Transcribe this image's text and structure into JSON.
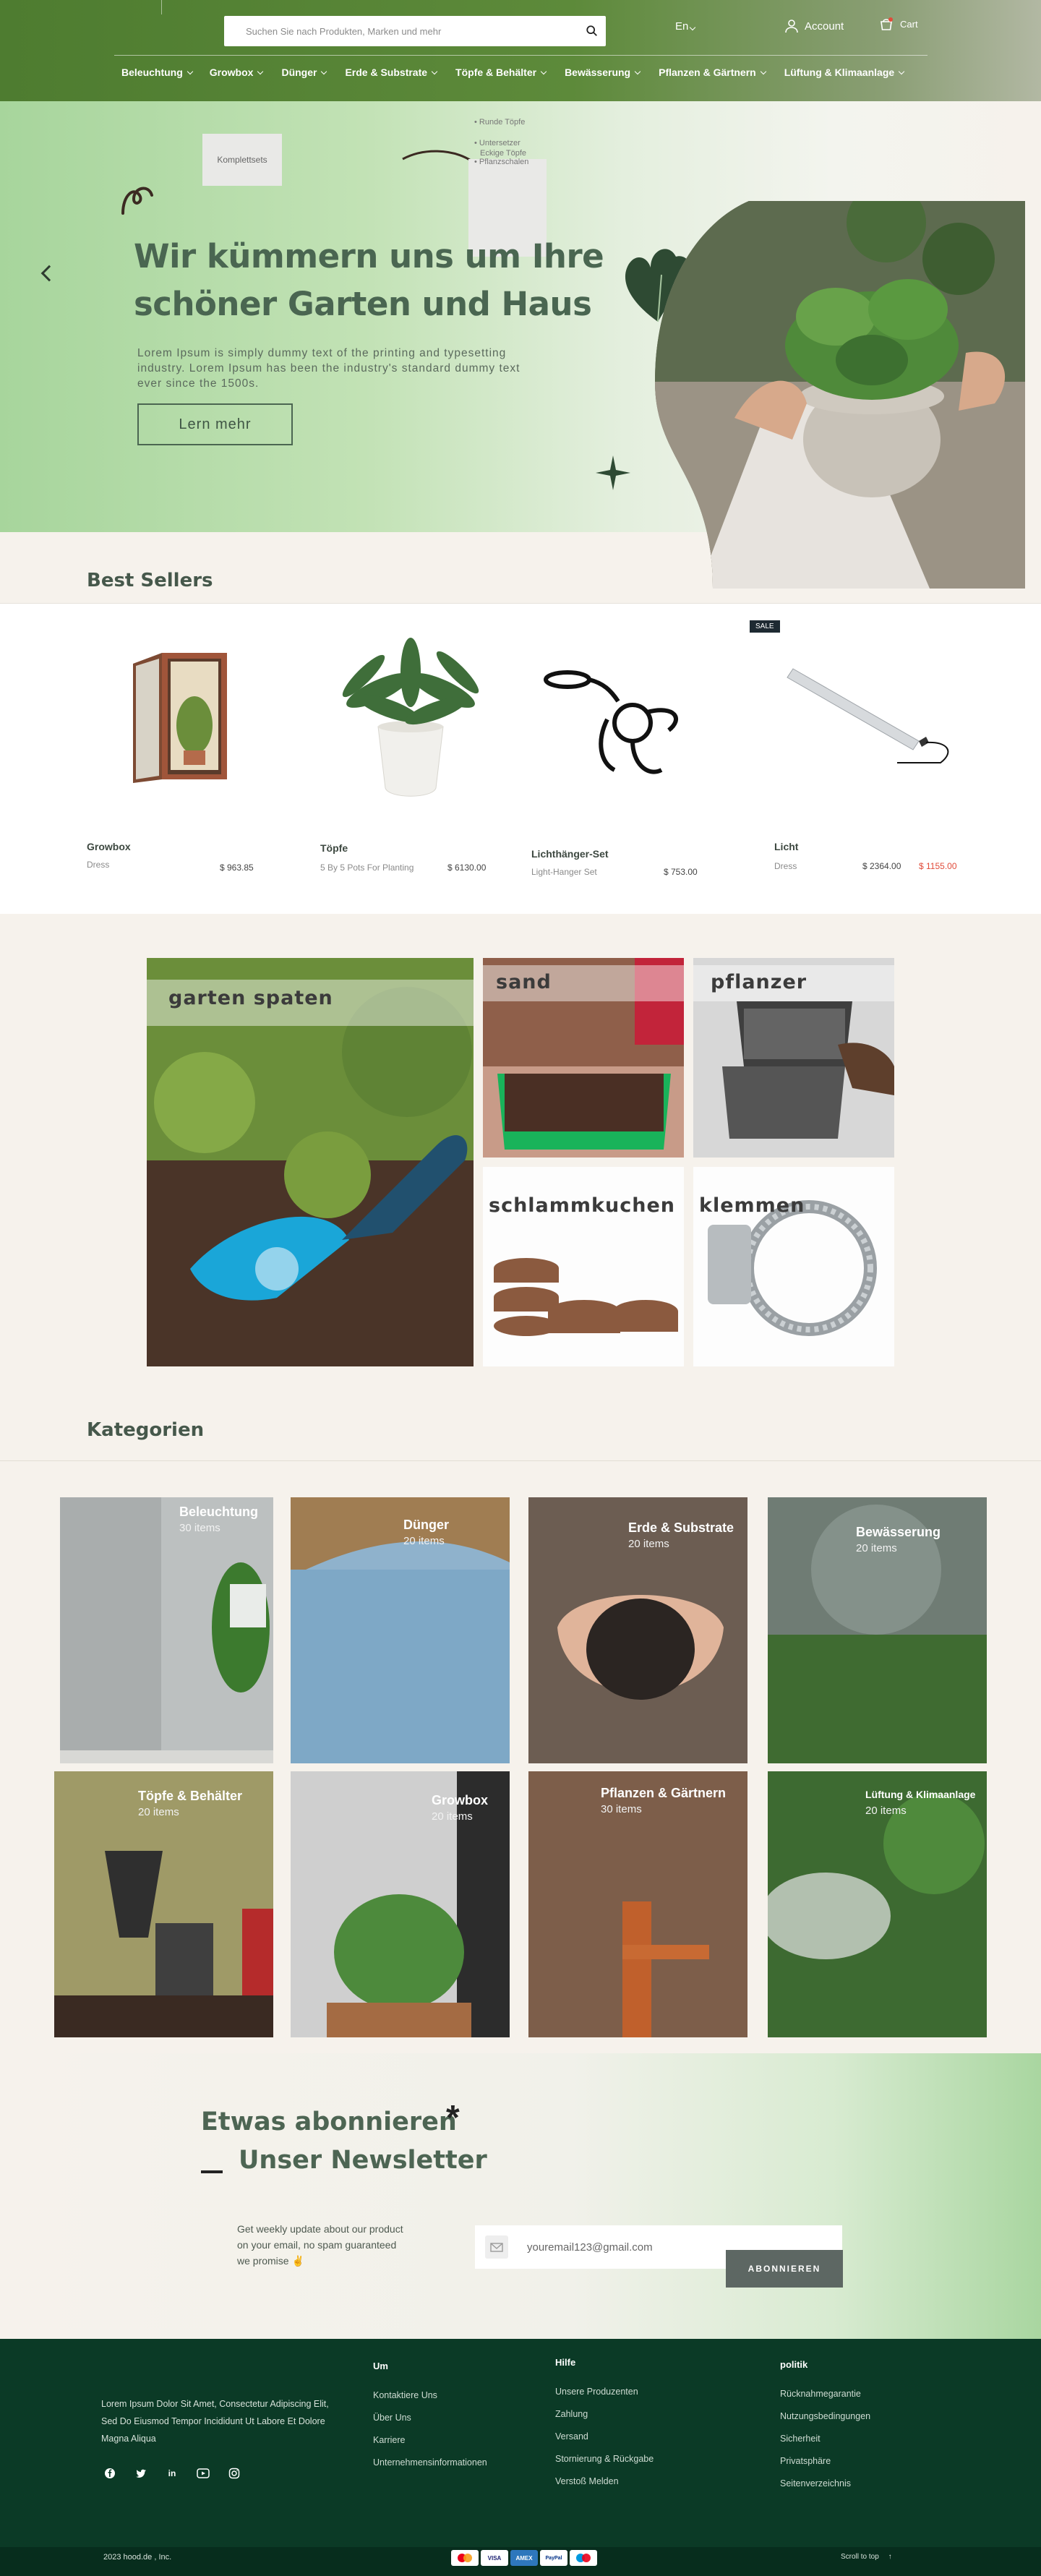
{
  "header": {
    "search_placeholder": "Suchen Sie nach Produkten, Marken und mehr",
    "language": "En",
    "account_label": "Account",
    "cart_label": "Cart",
    "nav": [
      "Beleuchtung",
      "Growbox",
      "Dünger",
      "Erde & Substrate",
      "Töpfe & Behälter",
      "Bewässerung",
      "Pflanzen & Gärtnern",
      "Lüftung & Klimaanlage"
    ],
    "dropdown_left": "Komplettsets",
    "dropdown_right": [
      "Runde Töpfe",
      "Untersetzer",
      "Eckige Töpfe",
      "Pflanzschalen"
    ]
  },
  "hero": {
    "title_line1": "Wir kümmern uns um Ihre",
    "title_line2": "schöner Garten und Haus",
    "text": "Lorem Ipsum is simply dummy text of the printing and typesetting industry. Lorem Ipsum has been the industry's standard dummy text ever since the 1500s.",
    "button": "Lern mehr"
  },
  "best_sellers": {
    "title": "Best Sellers",
    "sale_badge": "SALE",
    "products": [
      {
        "name": "Growbox",
        "sub": "Dress",
        "price": "$ 963.85",
        "old": ""
      },
      {
        "name": "Töpfe",
        "sub": "5 By 5 Pots For Planting",
        "price": "$ 6130.00",
        "old": ""
      },
      {
        "name": "Lichthänger-Set",
        "sub": "Light-Hanger Set",
        "price": "$ 753.00",
        "old": ""
      },
      {
        "name": "Licht",
        "sub": "Dress",
        "price": "$ 2364.00",
        "old": "$ 1155.00"
      }
    ]
  },
  "features": [
    "garten spaten",
    "sand",
    "pflanzer",
    "schlammkuchen",
    "klemmen"
  ],
  "categories": {
    "title": "Kategorien",
    "items": [
      {
        "name": "Beleuchtung",
        "count": "30 items"
      },
      {
        "name": "Dünger",
        "count": "20 items"
      },
      {
        "name": "Erde & Substrate",
        "count": "20 items"
      },
      {
        "name": "Bewässerung",
        "count": "20 items"
      },
      {
        "name": "Töpfe & Behälter",
        "count": "20 items"
      },
      {
        "name": "Growbox",
        "count": "20 items"
      },
      {
        "name": "Pflanzen & Gärtnern",
        "count": "30 items"
      },
      {
        "name": "Lüftung & Klimaanlage",
        "count": "20 items"
      }
    ]
  },
  "newsletter": {
    "title1": "Etwas abonnieren",
    "star": "*",
    "title2": "Unser Newsletter",
    "desc": "Get weekly update about our product on your email, no spam guaranteed we promise ✌",
    "email": "youremail123@gmail.com",
    "button": "ABONNIEREN"
  },
  "footer": {
    "about": "Lorem Ipsum Dolor Sit Amet, Consectetur Adipiscing Elit, Sed Do Eiusmod Tempor Incididunt Ut Labore Et Dolore Magna Aliqua",
    "col1_title": "Um",
    "col1": [
      "Kontaktiere Uns",
      "Über Uns",
      "Karriere",
      "Unternehmensinformationen"
    ],
    "col2_title": "Hilfe",
    "col2": [
      "Unsere Produzenten",
      "Zahlung",
      "Versand",
      "Stornierung & Rückgabe",
      "Verstoß Melden"
    ],
    "col3_title": "politik",
    "col3": [
      "Rücknahmegarantie",
      "Nutzungsbedingungen",
      "Sicherheit",
      "Privatsphäre",
      "Seitenverzeichnis"
    ],
    "copyright": "2023 hood.de , Inc.",
    "scroll": "Scroll to top",
    "payments": [
      "VISA",
      "AMEX",
      "PayPal"
    ]
  },
  "colors": {
    "header_green": "#4e7c30",
    "footer_green": "#0b3a26",
    "accent_text": "#4a6651",
    "sale_red": "#e14b3a"
  }
}
